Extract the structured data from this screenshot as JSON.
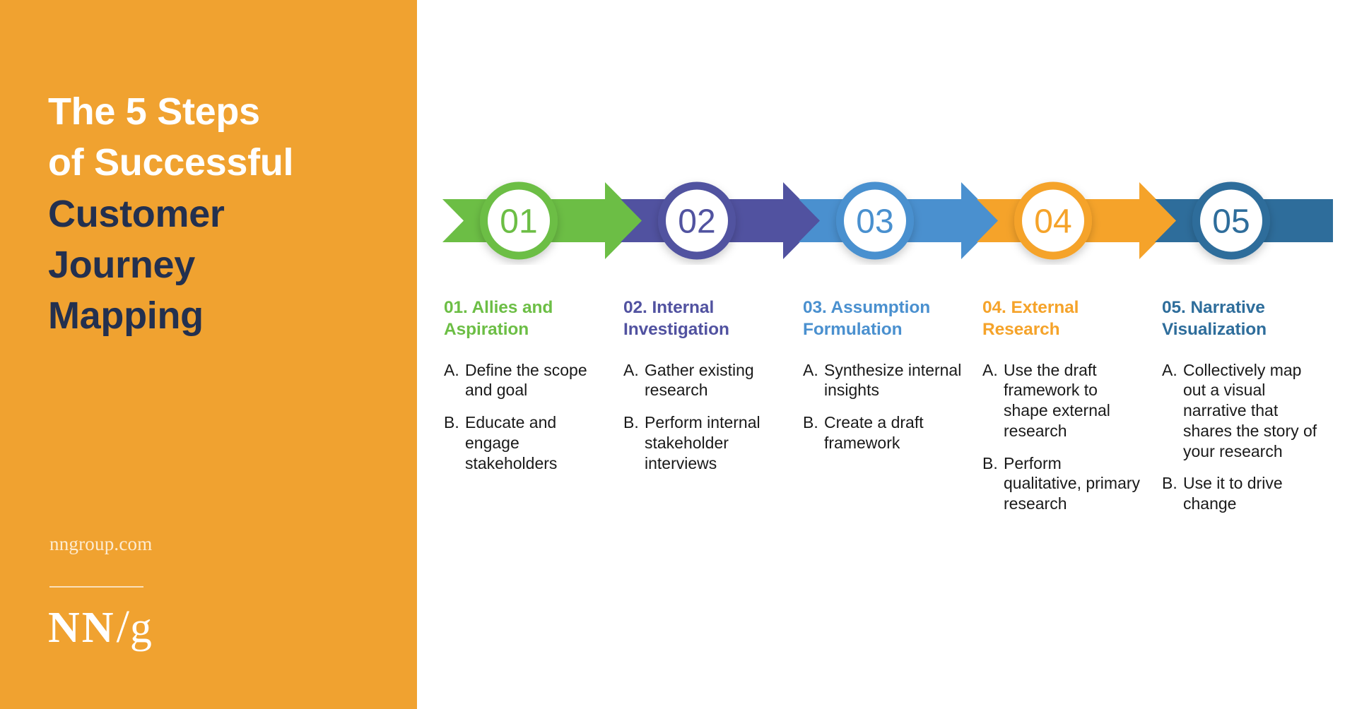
{
  "poster": {
    "title_lines": [
      {
        "text": "The 5 Steps",
        "tone": "light"
      },
      {
        "text": "of Successful",
        "tone": "light"
      },
      {
        "text": "Customer",
        "tone": "dark"
      },
      {
        "text": "Journey",
        "tone": "dark"
      },
      {
        "text": "Mapping",
        "tone": "dark"
      }
    ],
    "site_url": "nngroup.com",
    "logo": {
      "nn": "NN",
      "slash": "/",
      "g": "g"
    }
  },
  "colors": {
    "panel_orange": "#F0A230",
    "title_light": "#FFFFFF",
    "title_dark": "#23304F",
    "url_text": "#FDECD2",
    "background": "#FFFFFF",
    "body_text": "#1A1A1A"
  },
  "steps": [
    {
      "number": "01",
      "heading": "01. Allies and Aspiration",
      "color": "#6CBE45",
      "shape": "chevron",
      "substeps": [
        {
          "letter": "A.",
          "text": "Define the scope and goal"
        },
        {
          "letter": "B.",
          "text": "Educate and engage stakeholders"
        }
      ]
    },
    {
      "number": "02",
      "heading": "02. Internal Investigation",
      "color": "#5152A0",
      "shape": "chevron",
      "substeps": [
        {
          "letter": "A.",
          "text": "Gather existing research"
        },
        {
          "letter": "B.",
          "text": "Perform internal stakeholder interviews"
        }
      ]
    },
    {
      "number": "03",
      "heading": "03. Assumption Formulation",
      "color": "#4A90CF",
      "shape": "chevron",
      "substeps": [
        {
          "letter": "A.",
          "text": "Synthesize internal insights"
        },
        {
          "letter": "B.",
          "text": "Create a draft framework"
        }
      ]
    },
    {
      "number": "04",
      "heading": "04. External Research",
      "color": "#F5A32A",
      "shape": "chevron",
      "substeps": [
        {
          "letter": "A.",
          "text": "Use the draft framework to shape external research"
        },
        {
          "letter": "B.",
          "text": "Perform qualitative, primary research"
        }
      ]
    },
    {
      "number": "05",
      "heading": "05. Narrative Visualization",
      "color": "#2E6D9B",
      "shape": "ribbon",
      "substeps": [
        {
          "letter": "A.",
          "text": "Collectively map out a visual narrative that shares the story of your research"
        },
        {
          "letter": "B.",
          "text": "Use it to drive change"
        }
      ]
    }
  ]
}
